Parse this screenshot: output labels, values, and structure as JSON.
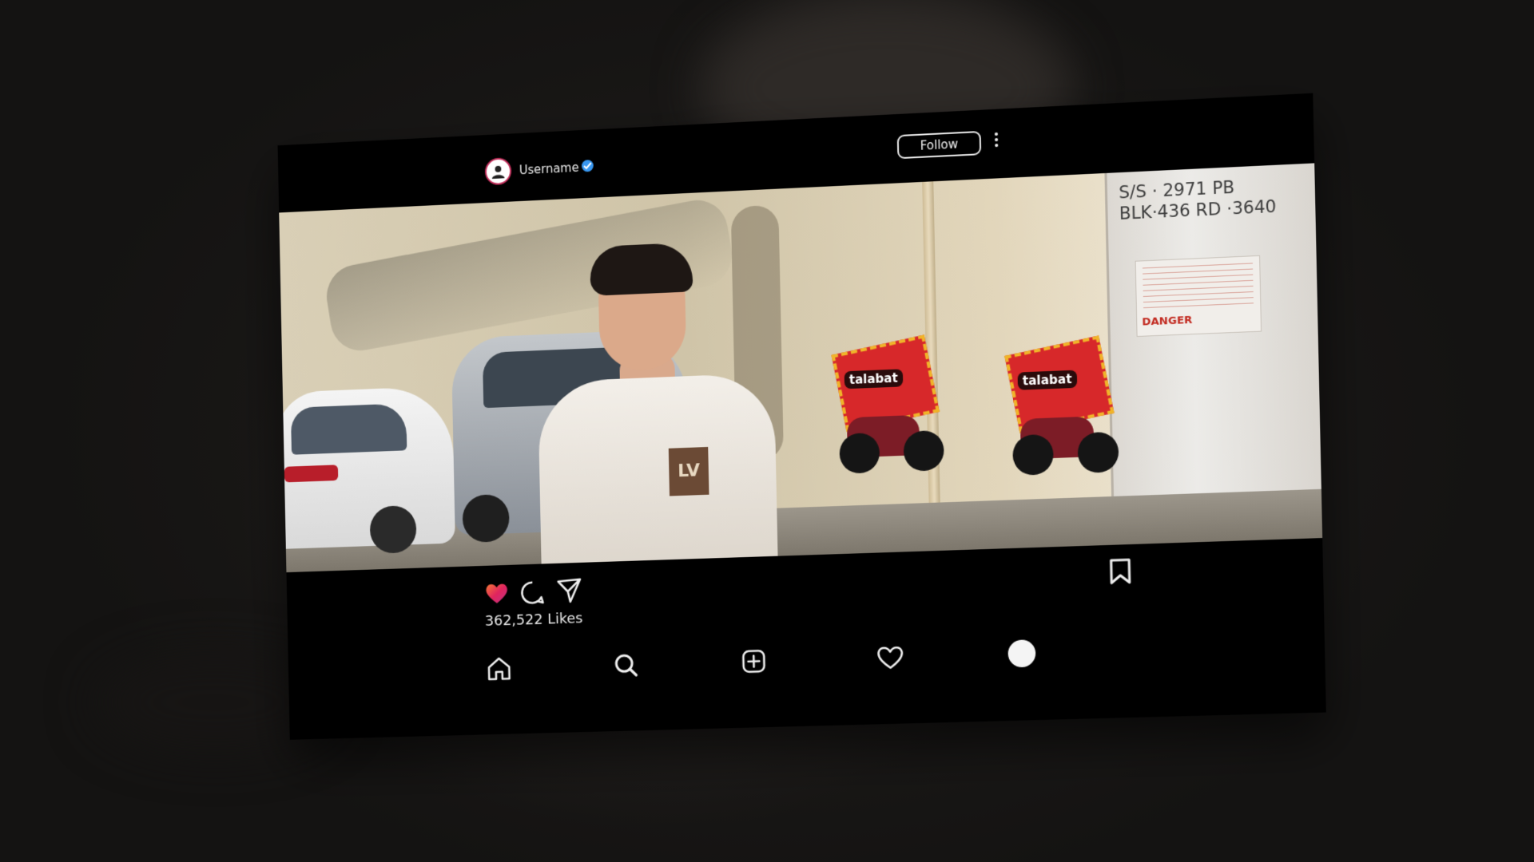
{
  "post": {
    "username": "Username",
    "follow_label": "Follow",
    "likes_text": "362,522 Likes",
    "photo": {
      "wall_sign": "S/S · 2971 PB\nBLK·436 RD ·3640",
      "danger_label": "DANGER",
      "delivery_box_text": "talabat",
      "shirt_logo": "LV"
    }
  },
  "colors": {
    "like_heart": "#e0245e",
    "verified_badge": "#3897f0",
    "card_background": "#000000"
  },
  "icons": {
    "post_actions": [
      "heart-icon",
      "comment-icon",
      "share-icon",
      "bookmark-icon"
    ],
    "bottom_nav": [
      "home-icon",
      "search-icon",
      "add-post-icon",
      "activity-heart-icon",
      "profile-icon"
    ]
  }
}
